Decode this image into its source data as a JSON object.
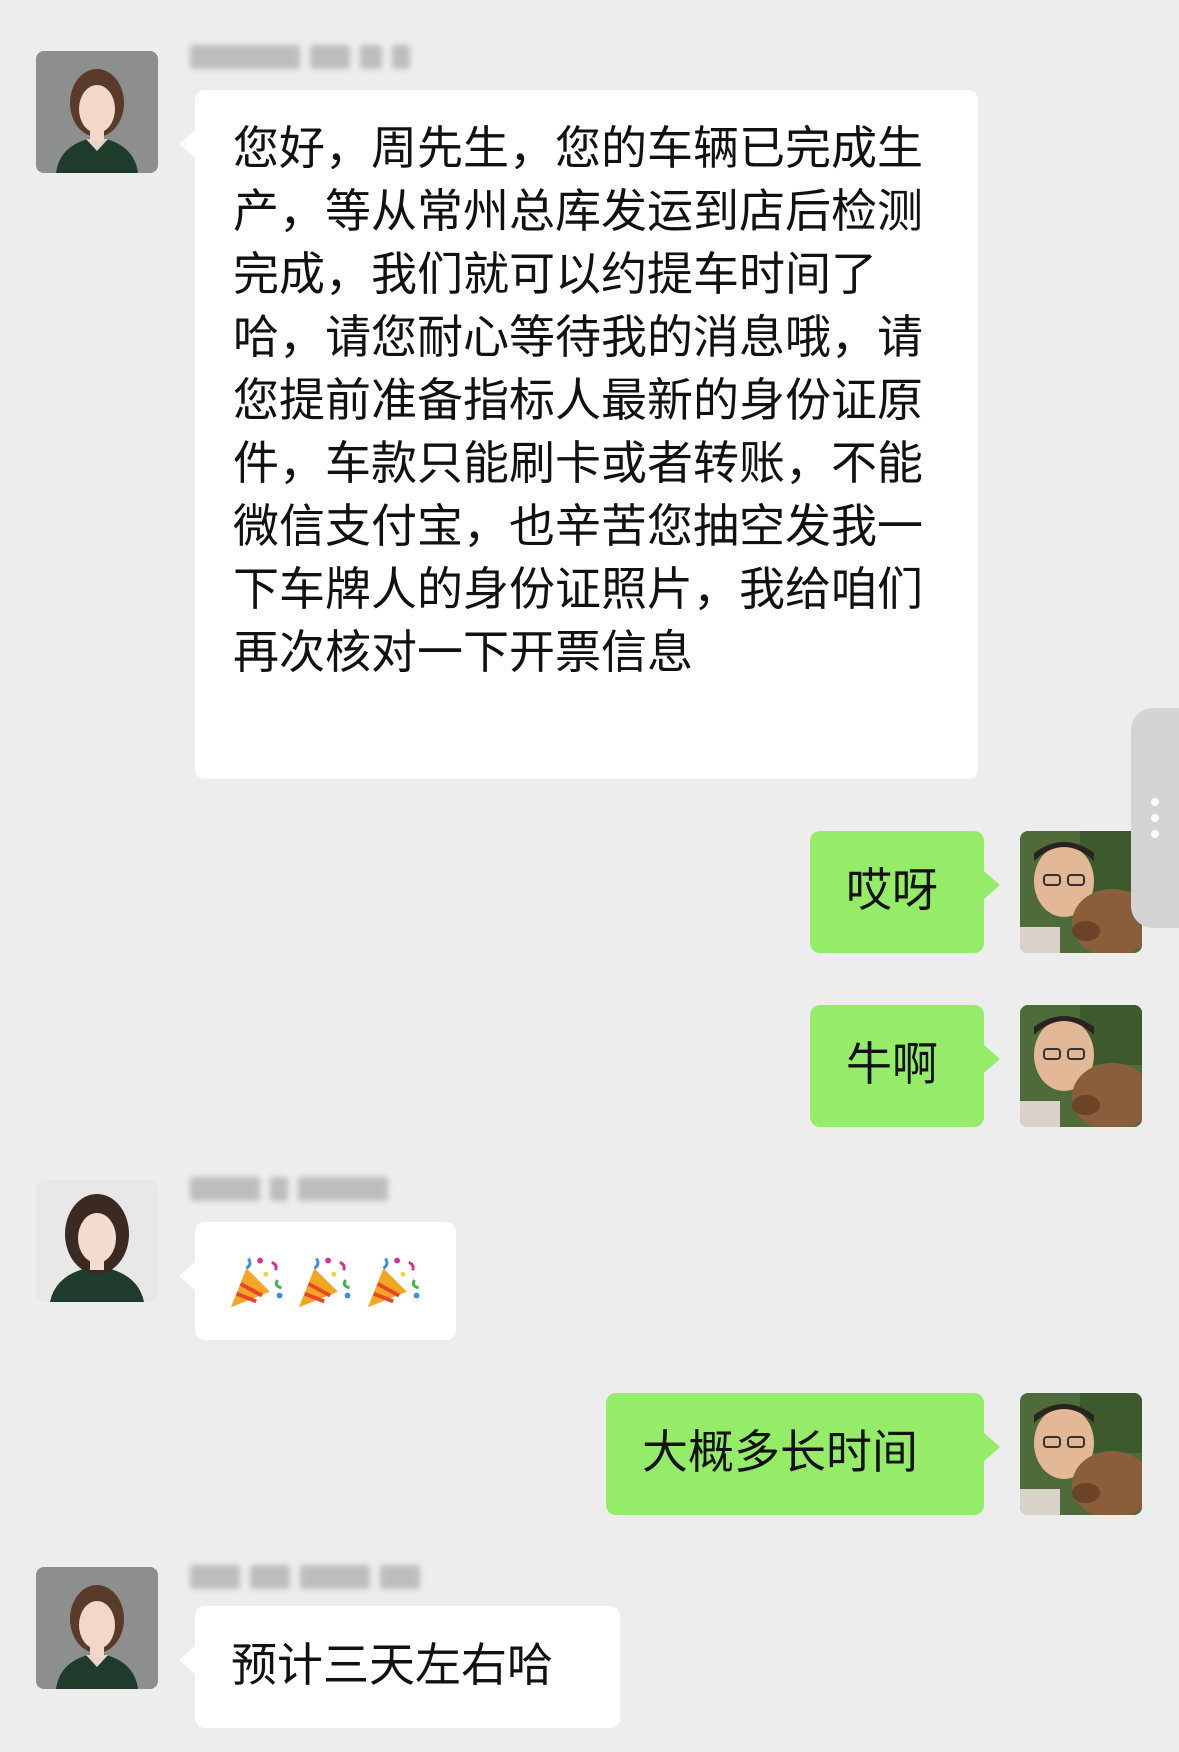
{
  "contacts": {
    "agent": {
      "name": ""
    },
    "me": {
      "name": ""
    }
  },
  "messages": [
    {
      "id": "m1",
      "direction": "in",
      "text": "您好，周先生，您的车辆已完成生产，等从常州总库发运到店后检测完成，我们就可以约提车时间了哈，请您耐心等待我的消息哦，请您提前准备指标人最新的身份证原件，车款只能刷卡或者转账，不能微信支付宝，也辛苦您抽空发我一下车牌人的身份证照片，我给咱们再次核对一下开票信息"
    },
    {
      "id": "m2",
      "direction": "out",
      "text": "哎呀"
    },
    {
      "id": "m3",
      "direction": "out",
      "text": "牛啊"
    },
    {
      "id": "m4",
      "direction": "in",
      "emoji": [
        "party-popper-icon",
        "party-popper-icon",
        "party-popper-icon"
      ]
    },
    {
      "id": "m5",
      "direction": "out",
      "text": "大概多长时间"
    },
    {
      "id": "m6",
      "direction": "in",
      "text": "预计三天左右哈"
    }
  ],
  "theme": {
    "background": "#ededed",
    "incoming_bubble": "#ffffff",
    "outgoing_bubble": "#95ec69",
    "text": "#111111"
  }
}
